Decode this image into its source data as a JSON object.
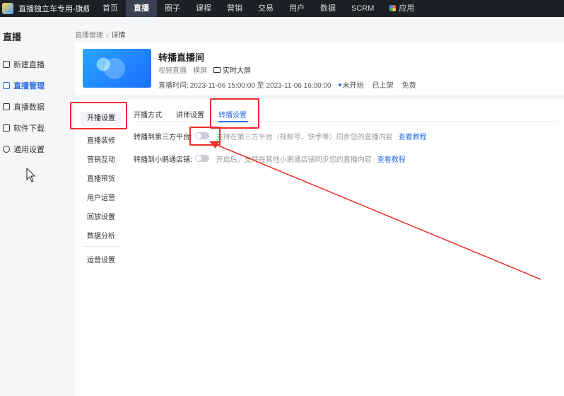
{
  "topbar": {
    "store_name": "直播独立车专用-旗舰...",
    "nav": [
      "首页",
      "直播",
      "圈子",
      "课程",
      "营销",
      "交易",
      "用户",
      "数据",
      "SCRM",
      "应用"
    ],
    "active_nav": "直播"
  },
  "sidebar": {
    "title": "直播",
    "items": [
      {
        "label": "新建直播",
        "icon": "video-plus-icon"
      },
      {
        "label": "直播管理",
        "icon": "live-manage-icon",
        "active": true
      },
      {
        "label": "直播数据",
        "icon": "chart-icon"
      },
      {
        "label": "软件下载",
        "icon": "download-icon"
      },
      {
        "label": "通用设置",
        "icon": "gear-icon"
      }
    ]
  },
  "breadcrumb": {
    "parent": "直播管理",
    "current": "详情"
  },
  "room": {
    "title": "转播直播间",
    "tags": [
      "视频直播",
      "横屏"
    ],
    "big_screen": "实时大屏",
    "time_label": "直播时间:",
    "time_range": "2023-11-06 15:00:00 至 2023-11-06 16:00:00",
    "status": "未开始",
    "shelf": "已上架",
    "price": "免费"
  },
  "subnav": {
    "items": [
      "开播设置",
      "直播装修",
      "营销互动",
      "直播带货",
      "用户运营",
      "回放设置",
      "数据分析",
      "运营设置"
    ],
    "active": "开播设置"
  },
  "tabs": {
    "items": [
      "开播方式",
      "讲师设置",
      "转播设置"
    ],
    "active": "转播设置"
  },
  "settings": [
    {
      "label": "转播到第三方平台:",
      "enabled": false,
      "desc": "支持在第三方平台（视频号、快手等）同步您的直播内容",
      "link": "查看教程"
    },
    {
      "label": "转播到小鹅通店铺:",
      "enabled": false,
      "desc": "开启后，支持在其他小鹅通店铺同步您的直播内容",
      "link": "查看教程"
    }
  ],
  "colors": {
    "accent": "#2b6de5",
    "annotation": "#ee2d2d",
    "topbar": "#1c1f26"
  }
}
